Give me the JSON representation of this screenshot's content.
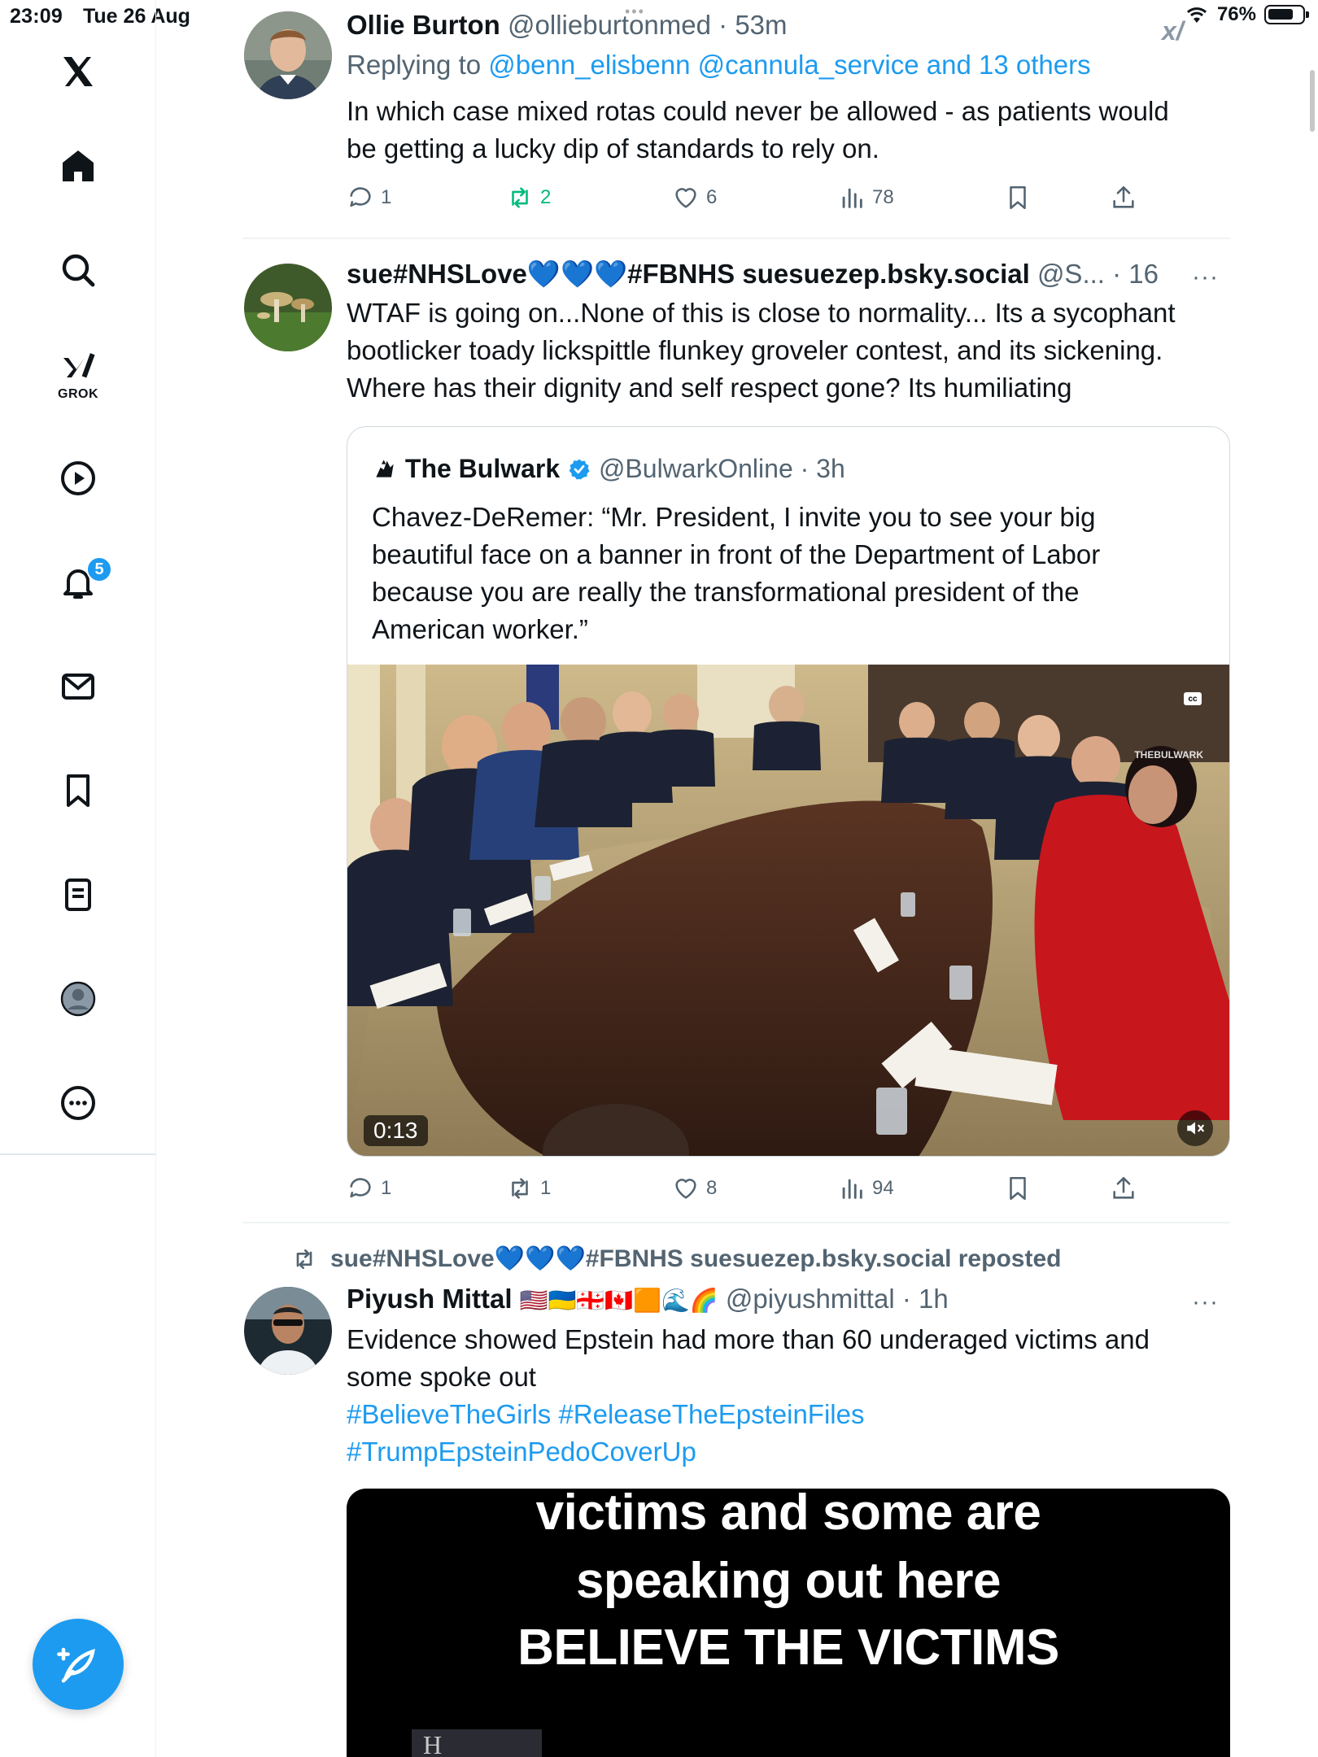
{
  "status_bar": {
    "time": "23:09",
    "date": "Tue 26 Aug",
    "battery": "76%",
    "battery_level": 0.76
  },
  "sidebar": {
    "grok_label": "GROK",
    "notification_count": "5",
    "items": [
      "x-logo",
      "home",
      "search",
      "grok",
      "video",
      "notifications",
      "messages",
      "bookmarks",
      "lists",
      "profile",
      "more"
    ]
  },
  "tweets": [
    {
      "name": "Ollie Burton",
      "handle": "@ollieburtonmed",
      "time": "· 53m",
      "reply_prefix": "Replying to",
      "reply_targets": "@benn_elisbenn @cannula_service and 13 others",
      "text_line1": "In which case mixed rotas could never be allowed - as patients would",
      "text_line2": "be getting a lucky dip of standards to rely on.",
      "replies": "1",
      "retweets": "2",
      "likes": "6",
      "views": "78"
    },
    {
      "name": "sue#NHSLove💙💙💙#FBNHS suesuezep.bsky.social",
      "handle": "@S...",
      "time": "· 16m",
      "more": "···",
      "text_line1": "WTAF is going on...None of this is close to normality... Its a sycophant",
      "text_line2": "bootlicker toady lickspittle flunkey groveler contest, and its sickening.",
      "text_line3": "Where has their dignity and self respect gone? Its humiliating",
      "quote": {
        "name": "The Bulwark",
        "handle": "@BulwarkOnline",
        "time": "· 3h",
        "text_line1": "Chavez-DeRemer: “Mr. President, I invite you to see your big",
        "text_line2": "beautiful face on a banner in front of the Department of Labor",
        "text_line3": "because you are really the transformational president of the",
        "text_line4": "American worker.”",
        "video_duration": "0:13",
        "cc_label": "cc",
        "watermark": "THEBULWARK"
      },
      "replies": "1",
      "retweets": "1",
      "likes": "8",
      "views": "94"
    },
    {
      "repost_by": "sue#NHSLove💙💙💙#FBNHS suesuezep.bsky.social reposted",
      "name": "Piyush Mittal",
      "emoji": "🇺🇸🇺🇦🇬🇪🇨🇦🟧🌊🌈",
      "handle": "@piyushmittal",
      "time": "· 1h",
      "more": "···",
      "text_line1": "Evidence showed Epstein had more than 60 underaged victims and",
      "text_line2": "some spoke out",
      "hashtags_line1": "#BelieveTheGirls #ReleaseTheEpsteinFiles",
      "hashtags_line2": "#TrumpEpsteinPedoCoverUp",
      "media_lines": [
        "victims and some are",
        "speaking out here",
        "BELIEVE THE VICTIMS"
      ]
    }
  ],
  "colors": {
    "accent": "#1d9bf0",
    "retweet_green": "#00ba7c",
    "muted": "#536471",
    "text": "#0f1419"
  }
}
